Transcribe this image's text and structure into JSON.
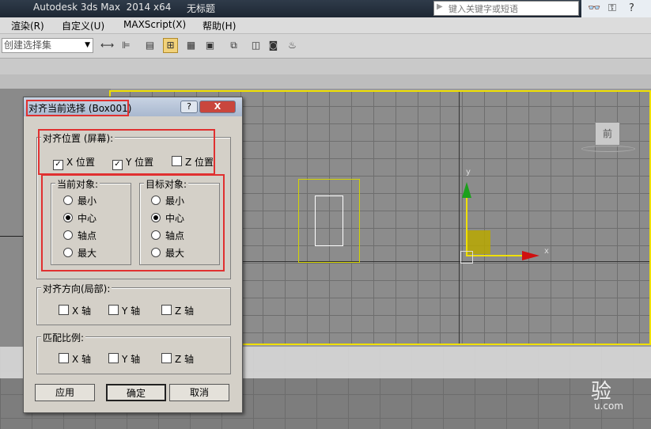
{
  "app": {
    "title": "Autodesk 3ds Max  2014 x64",
    "doc_title": "无标题",
    "search_placeholder": "键入关键字或短语"
  },
  "menu": [
    "渲染(R)",
    "自定义(U)",
    "MAXScript(X)",
    "帮助(H)"
  ],
  "toolbar": {
    "selection_set": "创建选择集"
  },
  "viewport": {
    "front_cube_label": "前",
    "axis_x": "x",
    "axis_y": "y"
  },
  "dialog": {
    "title": "对齐当前选择 (Box001)",
    "help": "?",
    "close": "X",
    "align_position": {
      "label": "对齐位置 (屏幕):",
      "x": "X 位置",
      "y": "Y 位置",
      "z": "Z 位置",
      "x_checked": true,
      "y_checked": true,
      "z_checked": false
    },
    "current_object": {
      "label": "当前对象:",
      "options": [
        "最小",
        "中心",
        "轴点",
        "最大"
      ],
      "selected": 1
    },
    "target_object": {
      "label": "目标对象:",
      "options": [
        "最小",
        "中心",
        "轴点",
        "最大"
      ],
      "selected": 1
    },
    "orientation": {
      "label": "对齐方向(局部):",
      "x": "X 轴",
      "y": "Y 轴",
      "z": "Z 轴"
    },
    "scale": {
      "label": "匹配比例:",
      "x": "X 轴",
      "y": "Y 轴",
      "z": "Z 轴"
    },
    "buttons": {
      "apply": "应用",
      "ok": "确定",
      "cancel": "取消"
    }
  },
  "watermark": {
    "text": "验",
    "site": "u.com"
  }
}
